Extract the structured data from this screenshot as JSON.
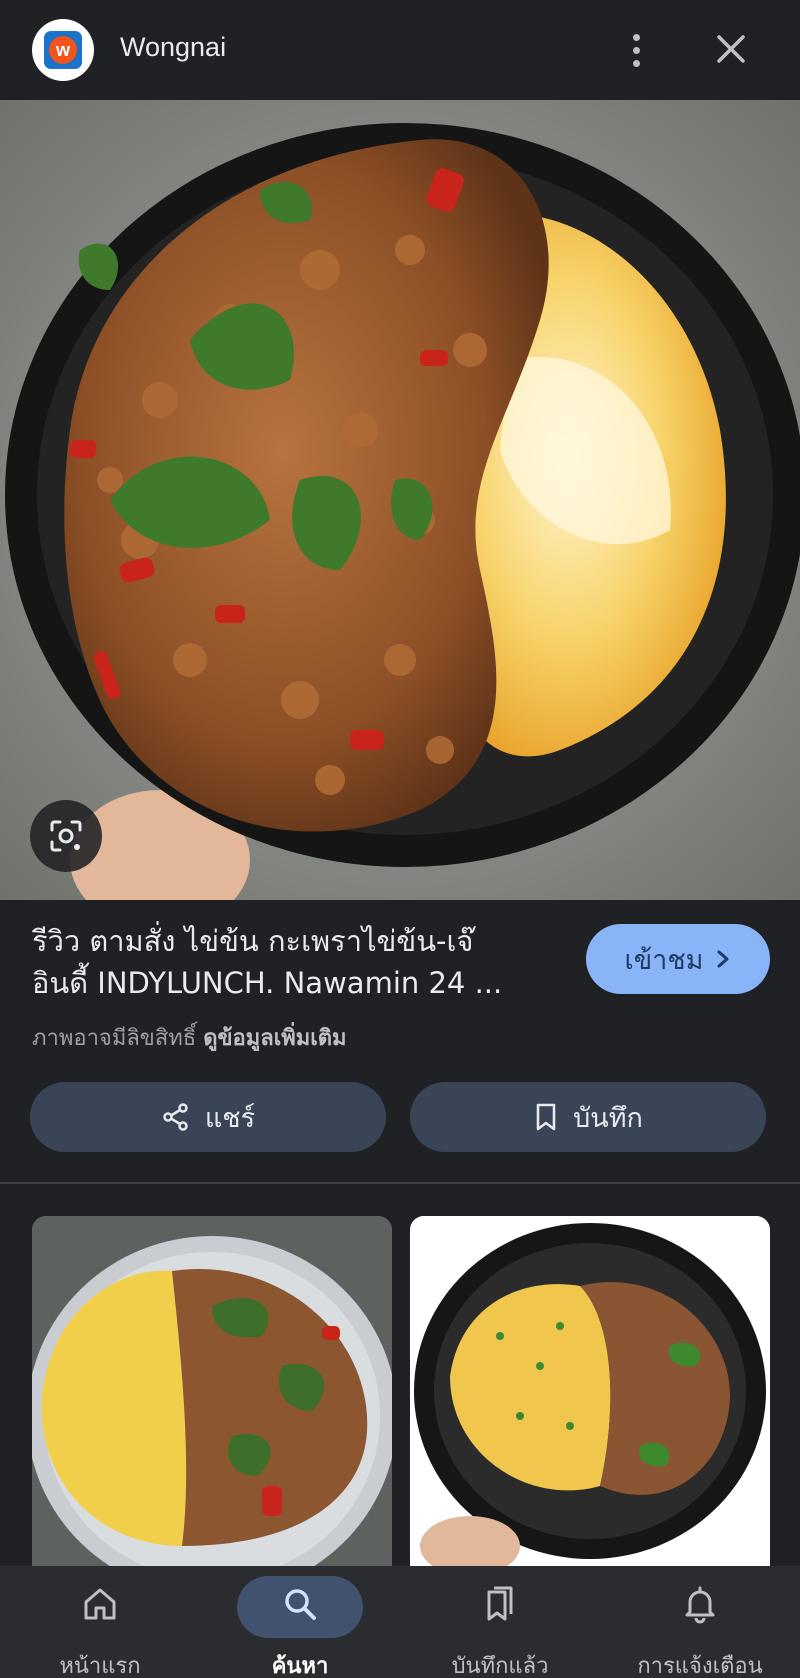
{
  "header": {
    "site_name": "Wongnai",
    "logo_letter": "w"
  },
  "result": {
    "title_line1": "รีวิว ตามสั่ง ไข่ข้น กะเพราไข่ข้น-เจ๊",
    "title_line2": "อินดี้ INDYLUNCH. Nawamin 24 ...",
    "visit_label": "เข้าชม",
    "rights_text": "ภาพอาจมีลิขสิทธิ์",
    "more_info_link": "ดูข้อมูลเพิ่มเติม"
  },
  "actions": {
    "share_label": "แชร์",
    "save_label": "บันทึก"
  },
  "nav": {
    "items": [
      {
        "label": "หน้าแรก",
        "icon": "home-icon"
      },
      {
        "label": "ค้นหา",
        "icon": "search-icon",
        "active": true
      },
      {
        "label": "บันทึกแล้ว",
        "icon": "saved-icon"
      },
      {
        "label": "การแจ้งเตือน",
        "icon": "bell-icon"
      }
    ]
  },
  "colors": {
    "background": "#202124",
    "accent": "#8ab4f8",
    "chip": "#394457",
    "nav_active_pill": "#41526e"
  }
}
